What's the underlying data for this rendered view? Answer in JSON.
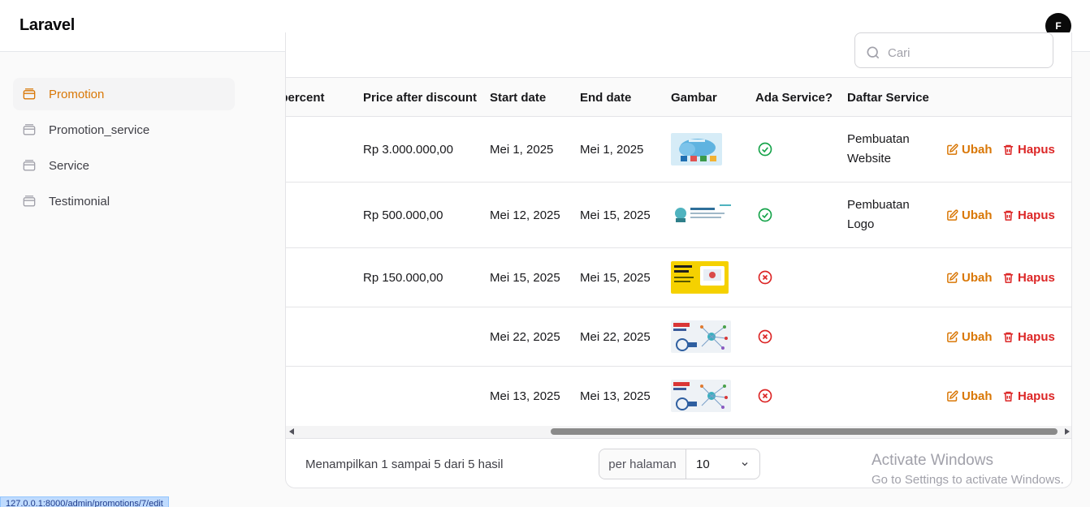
{
  "app": {
    "brand": "Laravel",
    "user_initial": "F"
  },
  "sidebar": {
    "items": [
      {
        "label": "Promotion",
        "active": true
      },
      {
        "label": "Promotion_service",
        "active": false
      },
      {
        "label": "Service",
        "active": false
      },
      {
        "label": "Testimonial",
        "active": false
      }
    ]
  },
  "search": {
    "placeholder": "Cari",
    "value": ""
  },
  "table": {
    "headers": {
      "discount_percent": "Discount percent",
      "price_after_discount": "Price after discount",
      "start_date": "Start date",
      "end_date": "End date",
      "gambar": "Gambar",
      "ada_service": "Ada Service?",
      "daftar_service": "Daftar Service"
    },
    "rows": [
      {
        "price_after_discount": "Rp 3.000.000,00",
        "start_date": "Mei 1, 2025",
        "end_date": "Mei 1, 2025",
        "image_icon": "web-service-image",
        "has_service": true,
        "service_name": "Pembuatan Website",
        "edit_label": "Ubah",
        "delete_label": "Hapus"
      },
      {
        "price_after_discount": "Rp 500.000,00",
        "start_date": "Mei 12, 2025",
        "end_date": "Mei 15, 2025",
        "image_icon": "logo-service-image",
        "has_service": true,
        "service_name": "Pembuatan Logo",
        "edit_label": "Ubah",
        "delete_label": "Hapus"
      },
      {
        "price_after_discount": "Rp 150.000,00",
        "start_date": "Mei 15, 2025",
        "end_date": "Mei 15, 2025",
        "image_icon": "yellow-promo-image",
        "has_service": false,
        "service_name": "",
        "edit_label": "Ubah",
        "delete_label": "Hapus"
      },
      {
        "price_after_discount": "",
        "start_date": "Mei 22, 2025",
        "end_date": "Mei 22, 2025",
        "image_icon": "seo-services-image",
        "has_service": false,
        "service_name": "",
        "edit_label": "Ubah",
        "delete_label": "Hapus"
      },
      {
        "price_after_discount": "",
        "start_date": "Mei 13, 2025",
        "end_date": "Mei 13, 2025",
        "image_icon": "seo-services-image",
        "has_service": false,
        "service_name": "",
        "edit_label": "Ubah",
        "delete_label": "Hapus"
      }
    ]
  },
  "pagination": {
    "summary": "Menampilkan 1 sampai 5 dari 5 hasil",
    "per_page_label": "per halaman",
    "per_page_value": "10"
  },
  "watermark": {
    "title": "Activate Windows",
    "subtitle": "Go to Settings to activate Windows."
  },
  "status_url": "127.0.0.1:8000/admin/promotions/7/edit",
  "colors": {
    "accent": "#d97706",
    "danger": "#dc2626",
    "success": "#16a34a"
  }
}
